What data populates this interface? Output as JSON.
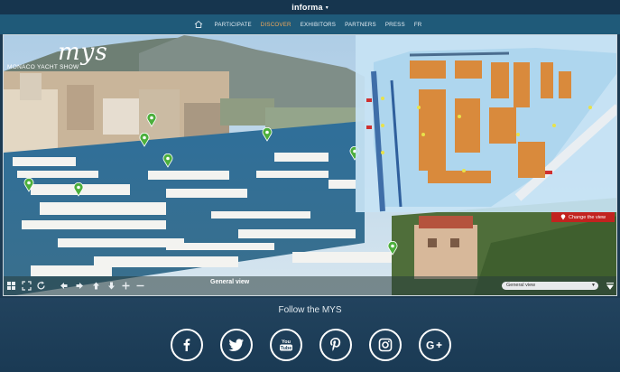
{
  "topbar": {
    "brand": "informa",
    "caret": "▾"
  },
  "nav": {
    "home_icon": "home-icon",
    "items": [
      {
        "label": "PARTICIPATE",
        "active": false
      },
      {
        "label": "DISCOVER",
        "active": true
      },
      {
        "label": "EXHIBITORS",
        "active": false
      },
      {
        "label": "PARTNERS",
        "active": false
      },
      {
        "label": "PRESS",
        "active": false
      },
      {
        "label": "FR",
        "active": false
      }
    ]
  },
  "logo": {
    "mark": "mys",
    "subtitle": "MONACO YACHT SHOW"
  },
  "viewer": {
    "change_view_label": "Change the view",
    "current_view_label": "General view",
    "select_value": "General view"
  },
  "footer": {
    "follow_label": "Follow the MYS",
    "social_icons": [
      "facebook-icon",
      "twitter-icon",
      "youtube-icon",
      "pinterest-icon",
      "instagram-icon",
      "google-plus-icon"
    ]
  },
  "colors": {
    "nav_active": "#f0a85a",
    "nav_bg": "#1f5a79",
    "topbar_bg": "#16354e",
    "change_view_bg": "#c2231f",
    "pin": "#4caf3c"
  }
}
